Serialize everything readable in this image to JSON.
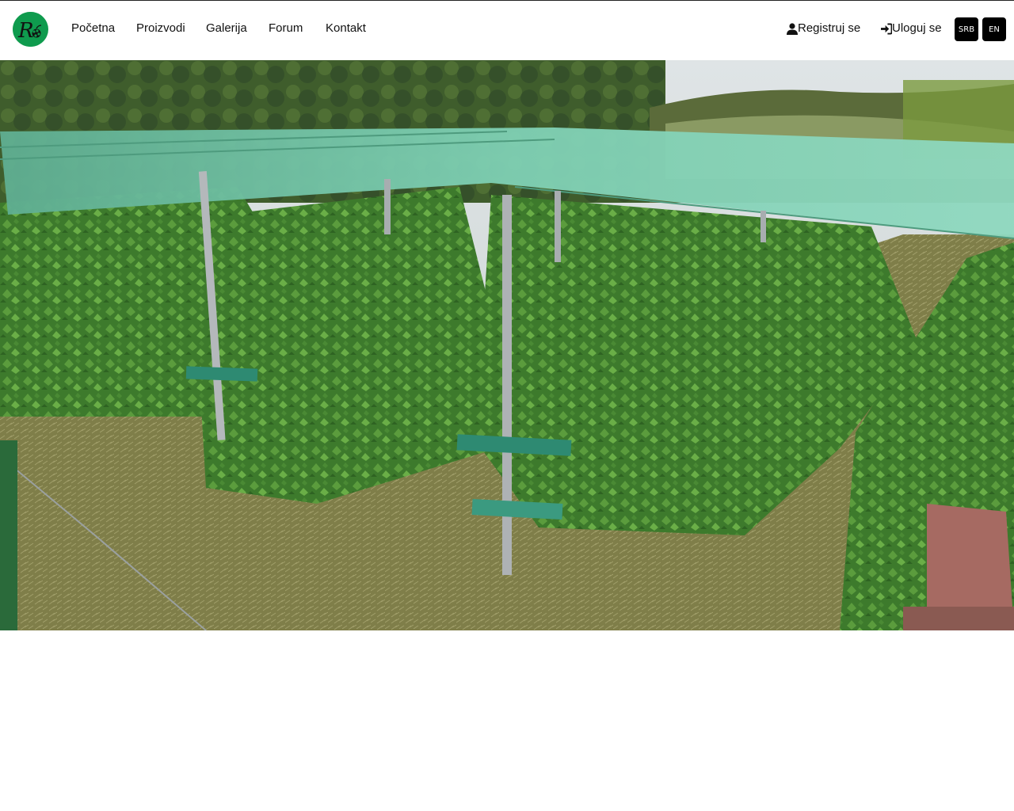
{
  "nav": {
    "logo_icon": "raspberry-logo-icon",
    "items": [
      {
        "label": "Početna"
      },
      {
        "label": "Proizvodi"
      },
      {
        "label": "Galerija"
      },
      {
        "label": "Forum"
      },
      {
        "label": "Kontakt"
      }
    ]
  },
  "auth": {
    "register_label": "Registruj se",
    "register_icon": "user-icon",
    "login_label": "Uloguj se",
    "login_icon": "sign-in-icon"
  },
  "languages": [
    "SRB",
    "EN"
  ],
  "hero": {
    "image": "raspberry-plantation-photo"
  },
  "colors": {
    "brand_green": "#0f9b4e",
    "net_green": "#6fc7a9",
    "button_black": "#000000"
  }
}
